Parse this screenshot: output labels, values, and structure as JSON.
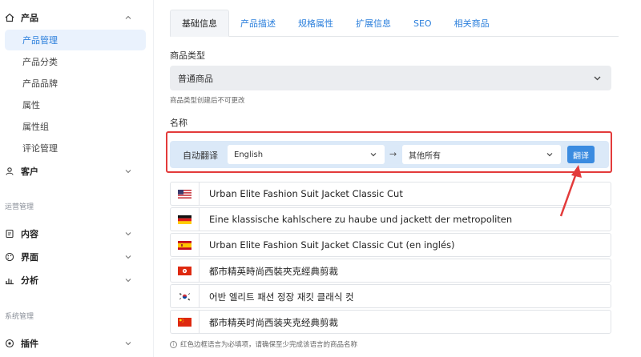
{
  "sidebar": {
    "groups": [
      {
        "label": "产品",
        "icon": "home-icon"
      },
      {
        "label": "客户",
        "icon": "user-icon"
      },
      {
        "label": "内容",
        "icon": "document-icon"
      },
      {
        "label": "界面",
        "icon": "palette-icon"
      },
      {
        "label": "分析",
        "icon": "bar-chart-icon"
      },
      {
        "label": "插件",
        "icon": "plugin-icon"
      }
    ],
    "product_items": [
      {
        "label": "产品管理",
        "active": true
      },
      {
        "label": "产品分类"
      },
      {
        "label": "产品品牌"
      },
      {
        "label": "属性"
      },
      {
        "label": "属性组"
      },
      {
        "label": "评论管理"
      }
    ],
    "sections": [
      "运营管理",
      "系统管理"
    ]
  },
  "tabs": [
    "基础信息",
    "产品描述",
    "规格属性",
    "扩展信息",
    "SEO",
    "相关商品"
  ],
  "form": {
    "product_type_label": "商品类型",
    "product_type_value": "普通商品",
    "product_type_hint": "商品类型创建后不可更改",
    "name_label": "名称"
  },
  "translate": {
    "label": "自动翻译",
    "source": "English",
    "arrow": "→",
    "target": "其他所有",
    "button": "翻译"
  },
  "languages": [
    {
      "flag": "us-flag-icon",
      "text": "Urban Elite Fashion Suit Jacket Classic Cut"
    },
    {
      "flag": "de-flag-icon",
      "text": "Eine klassische kahlschere zu haube und jackett der metropoliten"
    },
    {
      "flag": "es-flag-icon",
      "text": "Urban Elite Fashion Suit Jacket Classic Cut (en inglés)"
    },
    {
      "flag": "hk-flag-icon",
      "text": "都市精英時尚西裝夾克經典剪裁"
    },
    {
      "flag": "kr-flag-icon",
      "text": "어반 엘리트 패션 정장 재킷 클래식 컷"
    },
    {
      "flag": "cn-flag-icon",
      "text": "都市精英时尚西装夹克经典剪裁"
    }
  ],
  "footer_hint": "红色边框语言为必填项，请确保至少完成该语言的商品名称",
  "colors": {
    "accent": "#2b7fdc",
    "highlight": "#e33b3b",
    "button": "#3a8be0"
  }
}
